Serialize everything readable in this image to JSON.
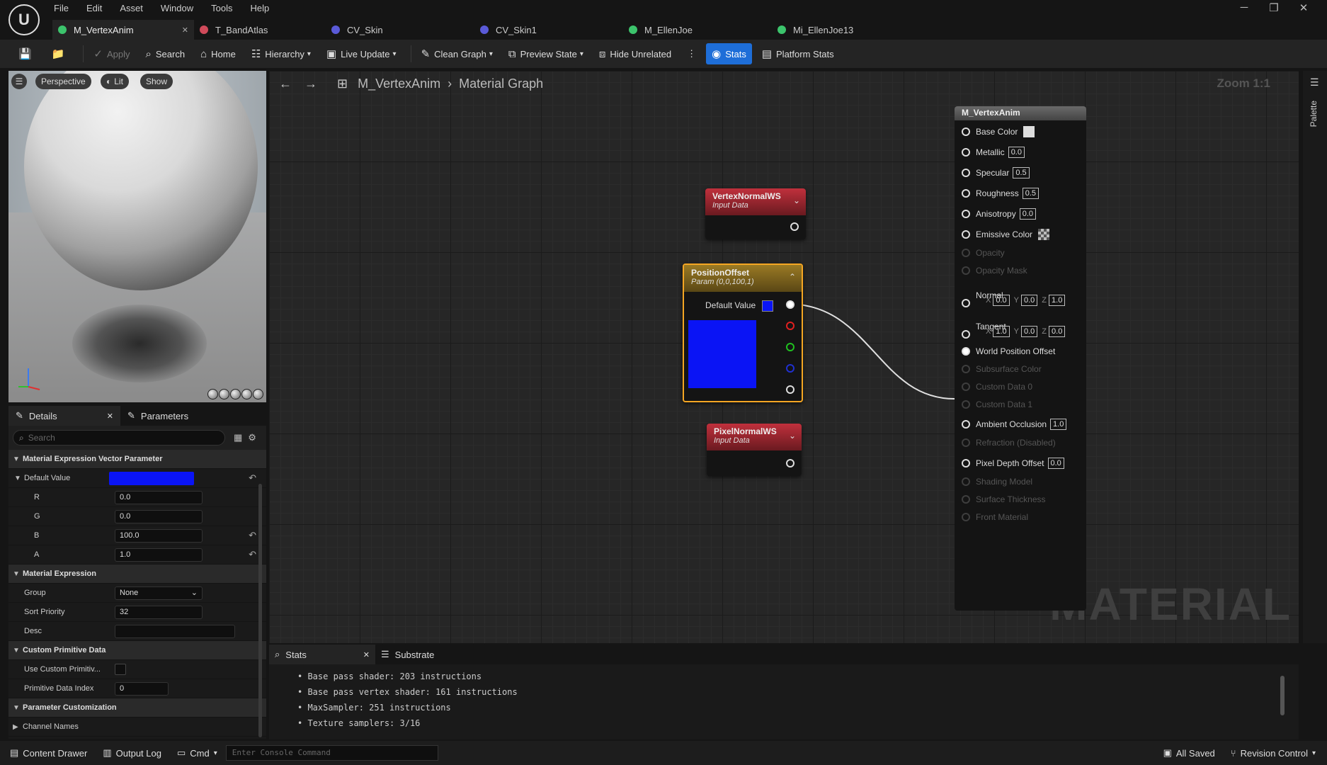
{
  "menu": [
    "File",
    "Edit",
    "Asset",
    "Window",
    "Tools",
    "Help"
  ],
  "window_controls": {
    "minimize": "─",
    "restore": "❐",
    "close": "✕"
  },
  "tabs": [
    {
      "label": "M_VertexAnim",
      "color": "#3cc46c",
      "close": "✕"
    },
    {
      "label": "T_BandAtlas",
      "color": "#d04a5a"
    },
    {
      "label": "CV_Skin",
      "color": "#5a5ad8"
    },
    {
      "label": "CV_Skin1",
      "color": "#5a5ad8"
    },
    {
      "label": "M_EllenJoe",
      "color": "#3cc46c"
    },
    {
      "label": "Mi_EllenJoe13",
      "color": "#3cc46c"
    }
  ],
  "toolbar": {
    "apply": "Apply",
    "search": "Search",
    "home": "Home",
    "hierarchy": "Hierarchy",
    "live_update": "Live Update",
    "clean_graph": "Clean Graph",
    "preview_state": "Preview State",
    "hide_unrelated": "Hide Unrelated",
    "stats": "Stats",
    "platform_stats": "Platform Stats"
  },
  "viewport": {
    "perspective": "Perspective",
    "lit": "Lit",
    "show": "Show"
  },
  "details": {
    "tab_details": "Details",
    "tab_parameters": "Parameters",
    "search_placeholder": "Search",
    "cat_vector": "Material Expression Vector Parameter",
    "default_value_label": "Default Value",
    "default_value_color": "#0a14f5",
    "r_label": "R",
    "r_value": "0.0",
    "g_label": "G",
    "g_value": "0.0",
    "b_label": "B",
    "b_value": "100.0",
    "a_label": "A",
    "a_value": "1.0",
    "cat_expr": "Material Expression",
    "group_label": "Group",
    "group_value": "None",
    "sort_label": "Sort Priority",
    "sort_value": "32",
    "desc_label": "Desc",
    "desc_value": "",
    "cat_custom": "Custom Primitive Data",
    "use_custom_label": "Use Custom Primitiv...",
    "prim_index_label": "Primitive Data Index",
    "prim_index_value": "0",
    "cat_param": "Parameter Customization",
    "channel_names": "Channel Names"
  },
  "graph": {
    "crumb_asset": "M_VertexAnim",
    "crumb_graph": "Material Graph",
    "zoom": "Zoom 1:1",
    "watermark": "MATERIAL",
    "node_vertex": {
      "title": "VertexNormalWS",
      "sub": "Input Data",
      "color": "#b5242f"
    },
    "node_position": {
      "title": "PositionOffset",
      "sub": "Param (0,0,100,1)",
      "default": "Default Value",
      "color": "#0a14f5",
      "header": "#8a6d1f"
    },
    "node_pixel": {
      "title": "PixelNormalWS",
      "sub": "Input Data",
      "color": "#b5242f"
    },
    "material": {
      "title": "M_VertexAnim",
      "base_color": "Base Color",
      "metallic": "Metallic",
      "metallic_v": "0.0",
      "specular": "Specular",
      "specular_v": "0.5",
      "roughness": "Roughness",
      "roughness_v": "0.5",
      "anisotropy": "Anisotropy",
      "anisotropy_v": "0.0",
      "emissive": "Emissive Color",
      "opacity": "Opacity",
      "opacity_mask": "Opacity Mask",
      "normal": "Normal",
      "normal_x": "0.0",
      "normal_y": "0.0",
      "normal_z": "1.0",
      "tangent": "Tangent",
      "tangent_x": "1.0",
      "tangent_y": "0.0",
      "tangent_z": "0.0",
      "wpo": "World Position Offset",
      "subsurface": "Subsurface Color",
      "cd0": "Custom Data 0",
      "cd1": "Custom Data 1",
      "ao": "Ambient Occlusion",
      "ao_v": "1.0",
      "refraction": "Refraction (Disabled)",
      "pdo": "Pixel Depth Offset",
      "pdo_v": "0.0",
      "shading": "Shading Model",
      "thickness": "Surface Thickness",
      "front": "Front Material"
    }
  },
  "palette": "Palette",
  "stats": {
    "tab_stats": "Stats",
    "tab_substrate": "Substrate",
    "lines": [
      "Base pass shader: 203 instructions",
      "Base pass vertex shader: 161 instructions",
      "MaxSampler: 251 instructions",
      "Texture samplers: 3/16"
    ]
  },
  "bottom": {
    "content_drawer": "Content Drawer",
    "output_log": "Output Log",
    "cmd": "Cmd",
    "console_placeholder": "Enter Console Command",
    "all_saved": "All Saved",
    "revision": "Revision Control"
  }
}
